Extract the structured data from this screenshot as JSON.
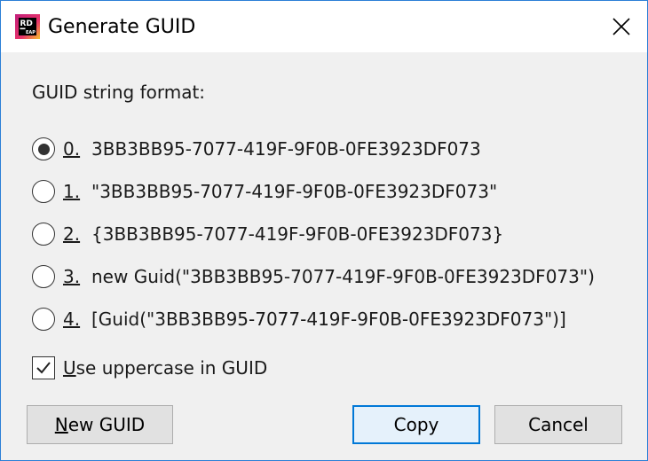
{
  "window": {
    "title": "Generate GUID",
    "logo": {
      "icon": "rider-eap-logo",
      "text_top": "RD",
      "text_bottom": "EAP"
    }
  },
  "guid_format": {
    "label": "GUID string format:",
    "selected_index": 0,
    "options": [
      {
        "num": "0.",
        "text": "3BB3BB95-7077-419F-9F0B-0FE3923DF073",
        "selected": true
      },
      {
        "num": "1.",
        "text": "\"3BB3BB95-7077-419F-9F0B-0FE3923DF073\"",
        "selected": false
      },
      {
        "num": "2.",
        "text": "{3BB3BB95-7077-419F-9F0B-0FE3923DF073}",
        "selected": false
      },
      {
        "num": "3.",
        "text": "new Guid(\"3BB3BB95-7077-419F-9F0B-0FE3923DF073\")",
        "selected": false
      },
      {
        "num": "4.",
        "text": "[Guid(\"3BB3BB95-7077-419F-9F0B-0FE3923DF073\")]",
        "selected": false
      }
    ]
  },
  "uppercase": {
    "checked": true,
    "mnemonic": "U",
    "rest": "se uppercase in GUID"
  },
  "buttons": {
    "new_guid": {
      "mnemonic": "N",
      "rest": "ew GUID"
    },
    "copy": "Copy",
    "cancel": "Cancel"
  },
  "colors": {
    "window_border": "#2b7fd6",
    "dialog_bg": "#f0f0f0",
    "default_button_border": "#0078d7",
    "logo_pink": "#e8336b",
    "logo_yellow": "#f6c12b"
  }
}
